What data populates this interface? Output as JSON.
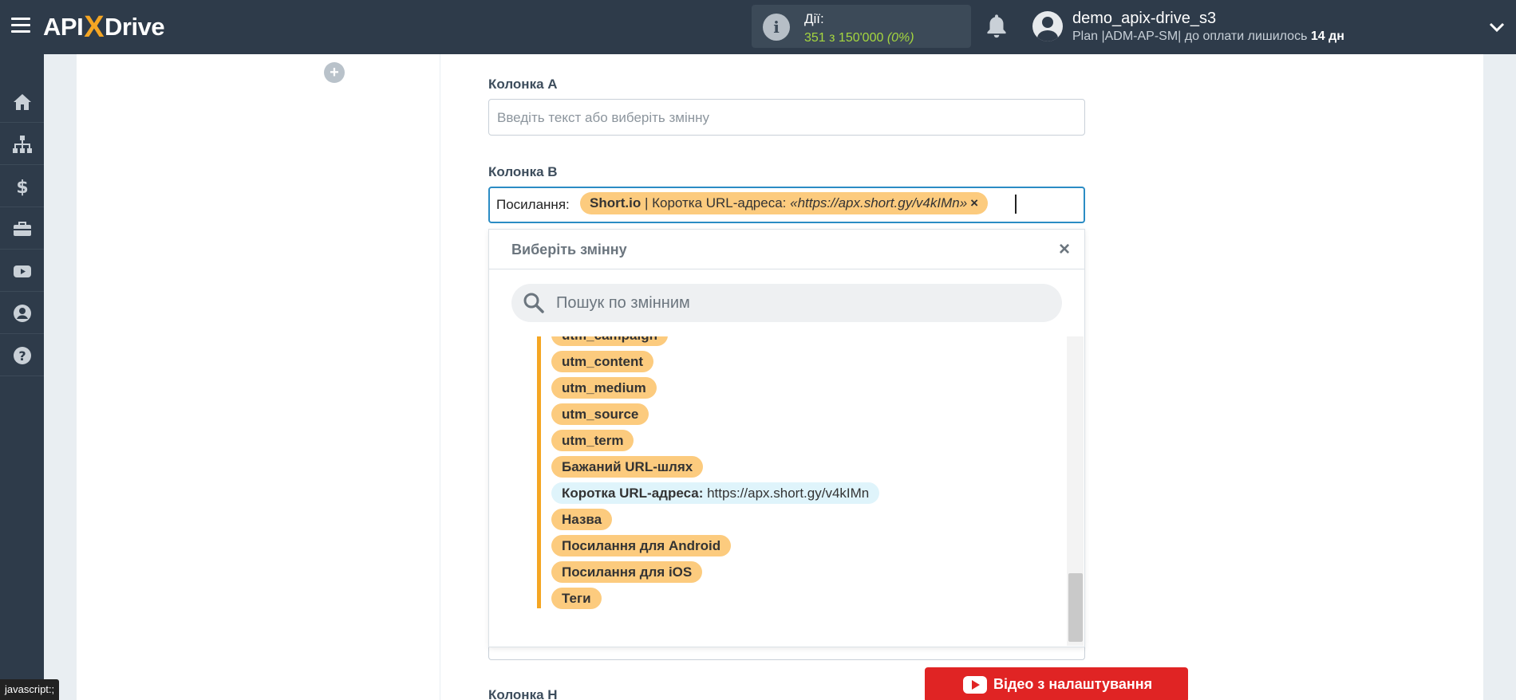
{
  "header": {
    "logo_part1": "API",
    "logo_x": "X",
    "logo_part2": "Drive",
    "actions_label": "Дії:",
    "actions_count": "351 з 150'000",
    "actions_pct": "(0%)",
    "username": "demo_apix-drive_s3",
    "plan_text": "Plan |ADM-AP-SM| до оплати лишилось",
    "plan_days": "14 дн"
  },
  "sidebar": {
    "items": [
      {
        "icon": "home-icon"
      },
      {
        "icon": "sitemap-icon"
      },
      {
        "icon": "dollar-icon"
      },
      {
        "icon": "briefcase-icon"
      },
      {
        "icon": "youtube-icon"
      },
      {
        "icon": "user-icon"
      },
      {
        "icon": "help-icon"
      }
    ]
  },
  "form": {
    "col_a_label": "Колонка A",
    "col_a_placeholder": "Введіть текст або виберіть змінну",
    "col_b_label": "Колонка B",
    "col_b_prefix": "Посилання:",
    "col_b_tag_source": "Short.io",
    "col_b_tag_field": " | Коротка URL-адреса: ",
    "col_b_tag_value": "«https://apx.short.gy/v4kIMn»",
    "col_b_tag_remove": "×",
    "col_h_label": "Колонка H"
  },
  "dropdown": {
    "title": "Виберіть змінну",
    "close": "×",
    "search_placeholder": "Пошук по змінним",
    "items": [
      {
        "label": "utm_campaign"
      },
      {
        "label": "utm_content"
      },
      {
        "label": "utm_medium"
      },
      {
        "label": "utm_source"
      },
      {
        "label": "utm_term"
      },
      {
        "label": "Бажаний URL-шлях"
      },
      {
        "label": "Коротка URL-адреса",
        "value": "https://apx.short.gy/v4kIMn",
        "highlight": true
      },
      {
        "label": "Назва"
      },
      {
        "label": "Посилання для Android"
      },
      {
        "label": "Посилання для iOS"
      },
      {
        "label": "Теги"
      }
    ]
  },
  "video_button": "Відео з налаштування",
  "status_bar": "javascript:;",
  "colors": {
    "topbar": "#2e3b4a",
    "accent_orange": "#f5a623",
    "tag_bg": "#fccb7e",
    "focus_border": "#2b8cc4",
    "video_red": "#e02424",
    "actions_green": "#a5d63f"
  }
}
